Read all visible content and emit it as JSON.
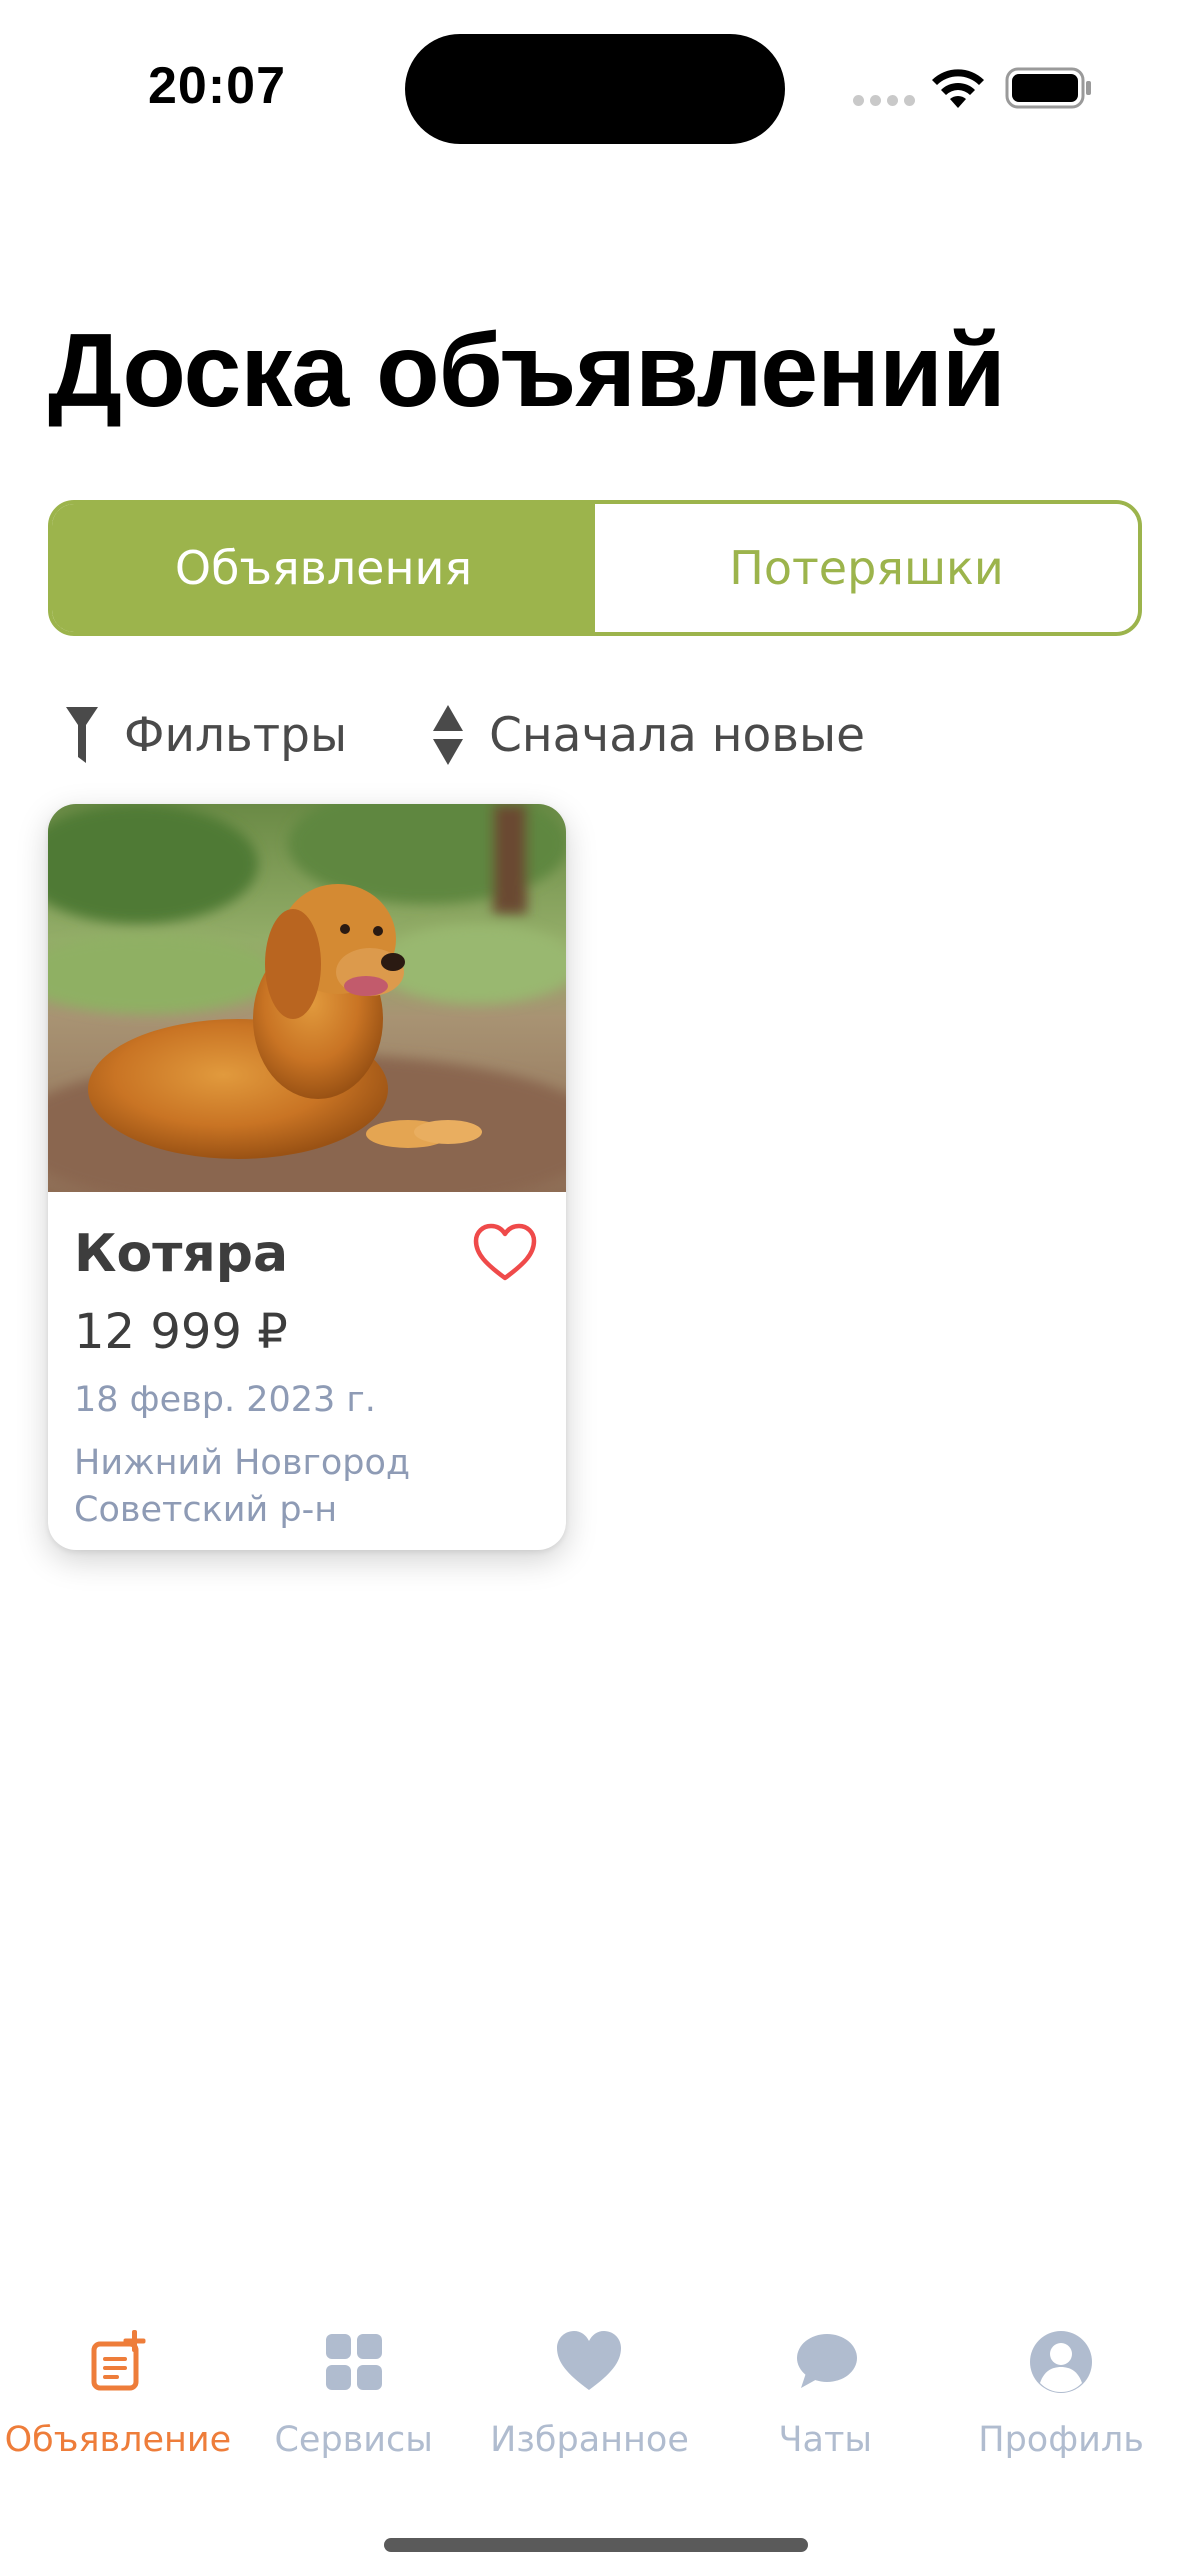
{
  "status_bar": {
    "time": "20:07",
    "signal_icon": "cellular-signal-icon",
    "wifi_icon": "wifi-icon",
    "battery_icon": "battery-full-icon"
  },
  "header": {
    "title": "Доска объявлений"
  },
  "segmented_control": {
    "items": [
      {
        "label": "Объявления",
        "active": true
      },
      {
        "label": "Потеряшки",
        "active": false
      }
    ],
    "accent_color": "#9cb44c"
  },
  "toolbar": {
    "filter_label": "Фильтры",
    "filter_icon": "funnel-icon",
    "sort_label": "Сначала новые",
    "sort_icon": "sort-updown-icon"
  },
  "listings": [
    {
      "title": "Котяра",
      "price": "12 999 ₽",
      "date": "18 февр. 2023 г.",
      "location_line1": "Нижний Новгород",
      "location_line2": "Советский р-н",
      "image": "golden-retriever-photo",
      "favorite_icon": "heart-outline-icon",
      "favorite_color": "#ef4a4a"
    }
  ],
  "tab_bar": {
    "active_color": "#ee7d3a",
    "inactive_color": "#b0bccf",
    "items": [
      {
        "label": "Объявление",
        "icon": "add-listing-icon",
        "active": true
      },
      {
        "label": "Сервисы",
        "icon": "grid-icon",
        "active": false
      },
      {
        "label": "Избранное",
        "icon": "heart-icon",
        "active": false
      },
      {
        "label": "Чаты",
        "icon": "chat-bubble-icon",
        "active": false
      },
      {
        "label": "Профиль",
        "icon": "profile-icon",
        "active": false
      }
    ]
  }
}
